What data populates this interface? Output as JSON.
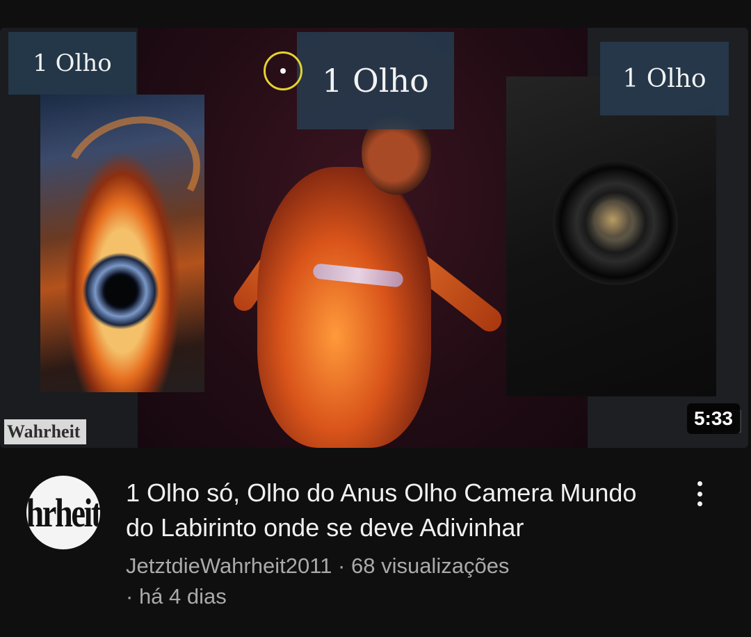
{
  "video": {
    "thumbnail": {
      "labels": [
        "1 Olho",
        "1 Olho",
        "1 Olho"
      ],
      "watermark": "Wahrheit"
    },
    "duration": "5:33",
    "title": "1 Olho só, Olho do Anus Olho Camera Mundo do Labirinto onde se deve Adivinhar",
    "channel": {
      "name": "JetztdieWahrheit2011",
      "avatar_text": "hrheit"
    },
    "meta": {
      "separator": " · ",
      "views": "68 visualizações",
      "age": "há 4 dias"
    }
  },
  "colors": {
    "background": "#0f0f0f",
    "title_text": "#f1f1f1",
    "meta_text": "#aaaaaa",
    "marker_ring": "#e5d330"
  },
  "icons": {
    "more_actions": "more-vertical-icon"
  }
}
